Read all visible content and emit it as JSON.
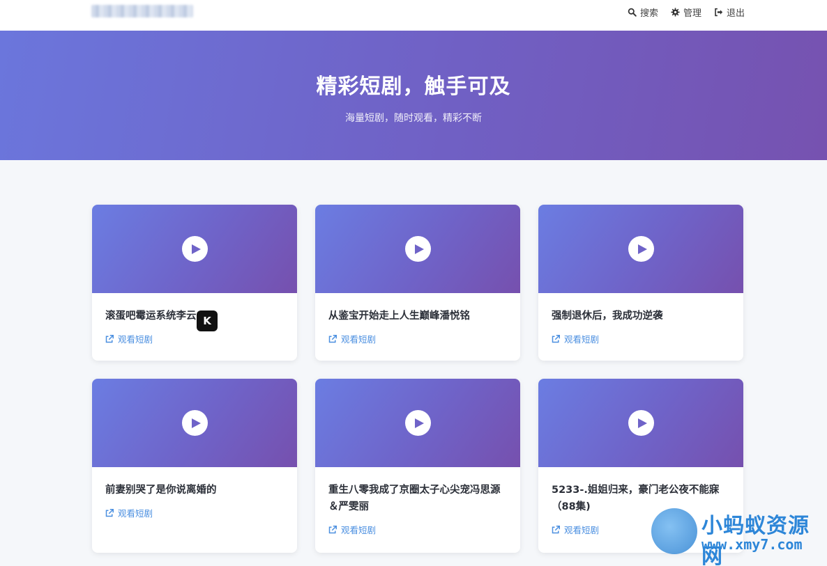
{
  "header": {
    "nav": [
      {
        "label": "搜索",
        "icon": "search-icon"
      },
      {
        "label": "管理",
        "icon": "gear-icon"
      },
      {
        "label": "退出",
        "icon": "logout-icon"
      }
    ]
  },
  "hero": {
    "title": "精彩短剧，触手可及",
    "subtitle": "海量短剧，随时观看，精彩不断"
  },
  "cards": [
    {
      "title": "滚蛋吧霉运系统李云",
      "action": "观看短剧"
    },
    {
      "title": "从鉴宝开始走上人生巅峰潘悦铭",
      "action": "观看短剧"
    },
    {
      "title": "强制退休后，我成功逆袭",
      "action": "观看短剧"
    },
    {
      "title": "前妻别哭了是你说离婚的",
      "action": "观看短剧"
    },
    {
      "title": "重生八零我成了京圈太子心尖宠冯思源＆严雯丽",
      "action": "观看短剧"
    },
    {
      "title": "5233-.姐姐归来，豪门老公夜不能寐（88集)",
      "action": "观看短剧"
    }
  ],
  "overlay_badge": {
    "text": "K"
  },
  "watermark": {
    "name": "小蚂蚁资源网",
    "url": "www.xmy7.com"
  },
  "colors": {
    "hero_start": "#6b76dc",
    "hero_end": "#7652b0",
    "link": "#4b8fe0",
    "watermark": "#2d86d8"
  }
}
